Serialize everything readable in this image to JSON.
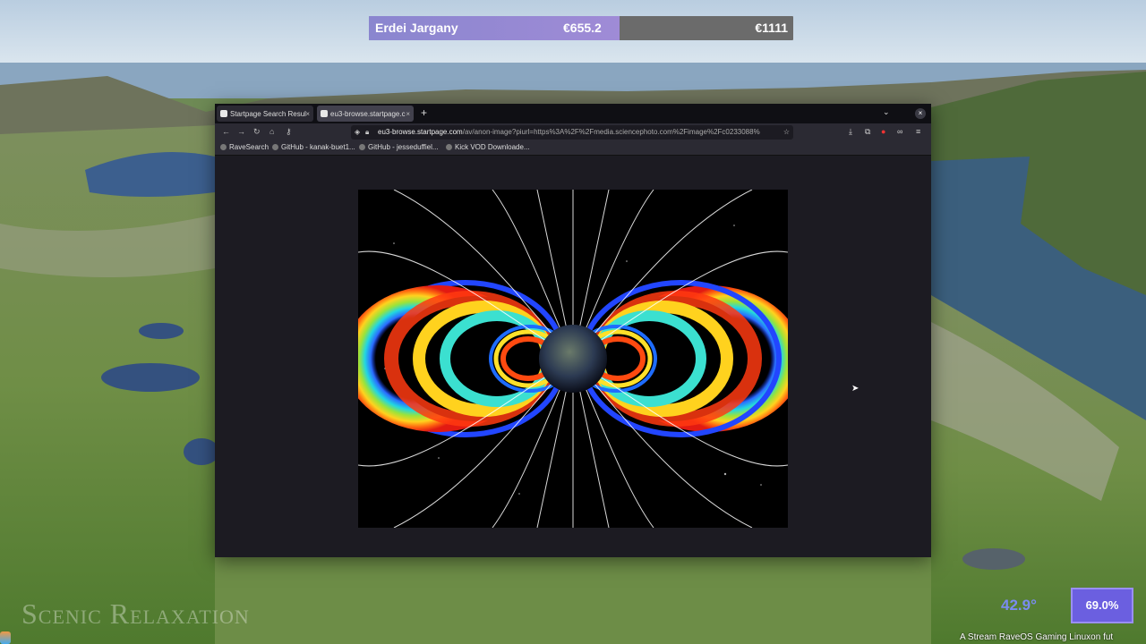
{
  "donation": {
    "name": "Erdei Jargany",
    "current": "€655.2",
    "goal": "€1111",
    "progress": 0.59
  },
  "browser": {
    "tabs": [
      {
        "label": "Startpage Search Resul",
        "active": false
      },
      {
        "label": "eu3-browse.startpage.c",
        "active": true
      }
    ],
    "new_tab": "+",
    "tab_list": "⌄",
    "close": "×",
    "url_host": "eu3-browse.startpage.com",
    "url_path": "/av/anon-image?piurl=https%3A%2F%2Fmedia.sciencephoto.com%2Fimage%2Fc0233088%",
    "bookmarks": [
      "RaveSearch",
      "GitHub - kanak-buet1...",
      "GitHub - jesseduffiel...",
      "Kick VOD Downloade..."
    ]
  },
  "overlay": {
    "watermark": "Scenic Relaxation",
    "temperature": "42.9°",
    "percent": "69.0%",
    "ticker": "A Stream RaveOS Gaming Linuxon fut"
  },
  "colors": {
    "accent": "#6b5fe0",
    "donation_fill": "#8a86cf"
  }
}
